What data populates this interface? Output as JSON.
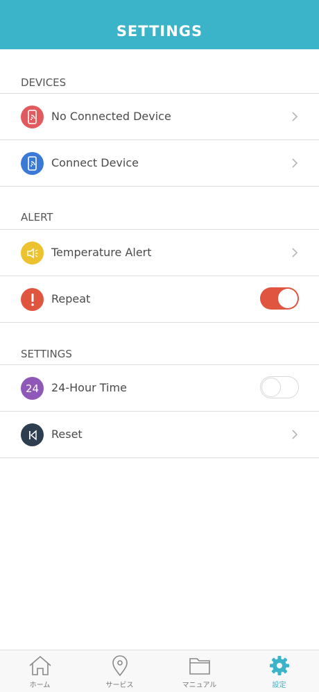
{
  "header": {
    "title": "SETTINGS"
  },
  "sections": {
    "devices": {
      "title": "DEVICES"
    },
    "alert": {
      "title": "ALERT"
    },
    "settings": {
      "title": "SETTINGS"
    }
  },
  "rows": {
    "no_connected_device": {
      "label": "No Connected Device",
      "icon": "phone-wifi-icon",
      "color": "#e05a5e"
    },
    "connect_device": {
      "label": "Connect Device",
      "icon": "phone-wifi-icon",
      "color": "#3a79d6"
    },
    "temperature_alert": {
      "label": "Temperature Alert",
      "icon": "speaker-icon",
      "color": "#ecc22e"
    },
    "repeat": {
      "label": "Repeat",
      "icon": "exclamation-icon",
      "color": "#e0553f",
      "toggle_on": true
    },
    "hour_time": {
      "label": "24-Hour Time",
      "icon_text": "24",
      "color": "#8e57b8",
      "toggle_on": false
    },
    "reset": {
      "label": "Reset",
      "icon": "skip-back-icon",
      "color": "#2c3e50"
    }
  },
  "tabs": [
    {
      "label": "ホーム",
      "icon": "home-icon",
      "active": false
    },
    {
      "label": "サービス",
      "icon": "location-pin-icon",
      "active": false
    },
    {
      "label": "マニュアル",
      "icon": "folder-icon",
      "active": false
    },
    {
      "label": "設定",
      "icon": "gear-icon",
      "active": true
    }
  ],
  "colors": {
    "accent": "#3bb3c9",
    "toggle_on": "#e0553f",
    "divider": "#dcdcdc"
  }
}
